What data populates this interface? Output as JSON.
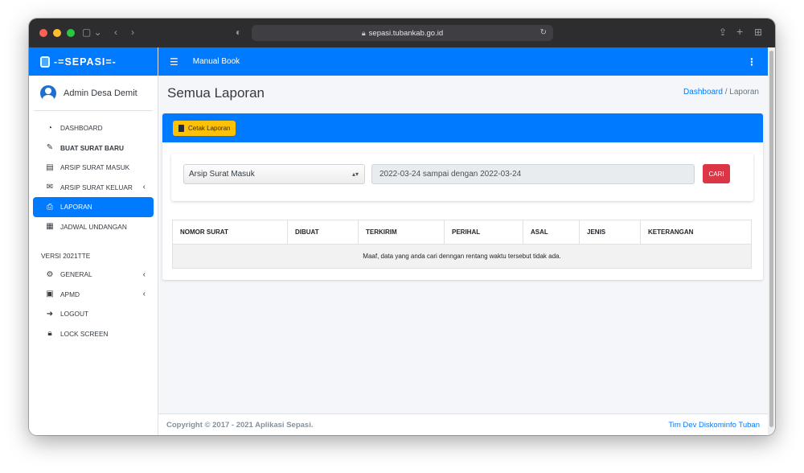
{
  "browser": {
    "url": "sepasi.tubankab.go.id"
  },
  "brand": {
    "name": "-=SEPASI=-"
  },
  "user": {
    "name": "Admin Desa Demit"
  },
  "topbar": {
    "manual_label": "Manual Book"
  },
  "sidebar": {
    "items": [
      {
        "label": "DASHBOARD",
        "icon": "tachometer-icon"
      },
      {
        "label": "BUAT SURAT BARU",
        "icon": "signature-icon"
      },
      {
        "label": "ARSIP SURAT MASUK",
        "icon": "inbox-icon"
      },
      {
        "label": "ARSIP SURAT KELUAR",
        "icon": "mail-bulk-icon"
      },
      {
        "label": "LAPORAN",
        "icon": "print-icon"
      },
      {
        "label": "JADWAL UNDANGAN",
        "icon": "calendar-icon"
      }
    ],
    "version_header": "VERSI 2021TTE",
    "items2": [
      {
        "label": "GENERAL",
        "icon": "cog-icon"
      },
      {
        "label": "APMD",
        "icon": "id-card-icon"
      },
      {
        "label": "LOGOUT",
        "icon": "sign-out-icon"
      },
      {
        "label": "LOCK SCREEN",
        "icon": "lock-icon"
      }
    ]
  },
  "page": {
    "title": "Semua Laporan",
    "breadcrumb_link": "Dashboard",
    "breadcrumb_sep": "/",
    "breadcrumb_current": "Laporan"
  },
  "card": {
    "print_button": "Cetak Laporan",
    "select_value": "Arsip Surat Masuk",
    "date_range": "2022-03-24 sampai dengan 2022-03-24",
    "search_button": "CARI"
  },
  "table": {
    "headers": [
      "NOMOR SURAT",
      "DIBUAT",
      "TERKIRIM",
      "PERIHAL",
      "ASAL",
      "JENIS",
      "KETERANGAN"
    ],
    "empty_message": "Maaf, data yang anda cari denngan rentang waktu tersebut tidak ada."
  },
  "footer": {
    "copyright": "Copyright © 2017 - 2021 Aplikasi Sepasi.",
    "team": "Tim Dev Diskominfo Tuban"
  },
  "colors": {
    "primary": "#007bff",
    "warning": "#ffc107",
    "danger": "#dc3545"
  }
}
